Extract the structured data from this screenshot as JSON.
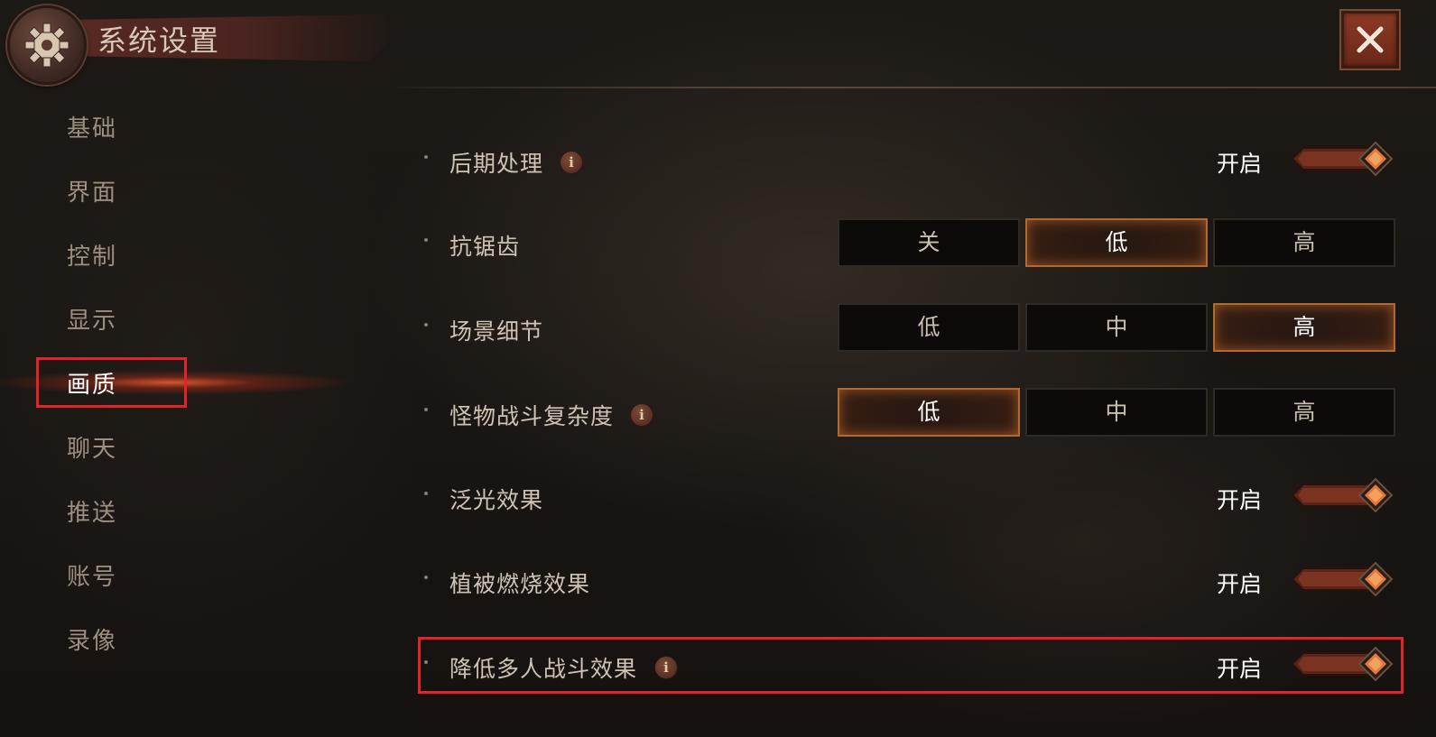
{
  "header": {
    "title": "系统设置",
    "gear_icon": "gear-icon",
    "close_icon": "close-icon"
  },
  "sidebar": {
    "items": [
      {
        "label": "基础",
        "active": false
      },
      {
        "label": "界面",
        "active": false
      },
      {
        "label": "控制",
        "active": false
      },
      {
        "label": "显示",
        "active": false
      },
      {
        "label": "画质",
        "active": true
      },
      {
        "label": "聊天",
        "active": false
      },
      {
        "label": "推送",
        "active": false
      },
      {
        "label": "账号",
        "active": false
      },
      {
        "label": "录像",
        "active": false
      }
    ]
  },
  "settings": {
    "post_processing": {
      "label": "后期处理",
      "has_info": true,
      "state": "开启",
      "on": true
    },
    "anti_aliasing": {
      "label": "抗锯齿",
      "options": [
        "关",
        "低",
        "高"
      ],
      "selected": "低"
    },
    "scene_detail": {
      "label": "场景细节",
      "options": [
        "低",
        "中",
        "高"
      ],
      "selected": "高"
    },
    "monster_complexity": {
      "label": "怪物战斗复杂度",
      "has_info": true,
      "options": [
        "低",
        "中",
        "高"
      ],
      "selected": "低"
    },
    "bloom": {
      "label": "泛光效果",
      "state": "开启",
      "on": true
    },
    "vegetation_burn": {
      "label": "植被燃烧效果",
      "state": "开启",
      "on": true
    },
    "reduce_multiplayer": {
      "label": "降低多人战斗效果",
      "has_info": true,
      "state": "开启",
      "on": true
    }
  },
  "info_glyph": "i",
  "colors": {
    "accent": "#b06a30",
    "highlight_box": "#e4222b",
    "toggle_knob": "#e0793a"
  }
}
